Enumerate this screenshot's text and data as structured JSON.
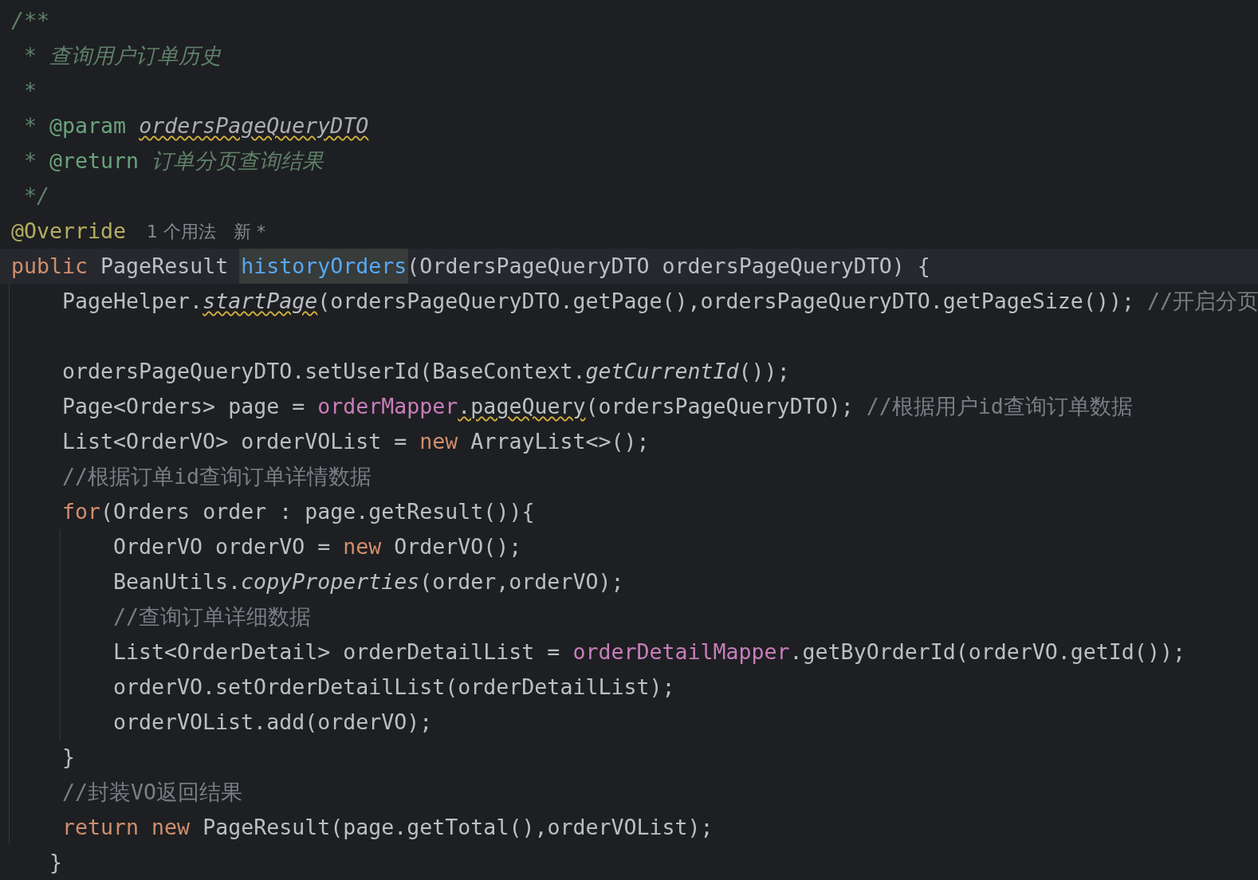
{
  "editor": {
    "lines": [
      {
        "kind": "code",
        "current": false,
        "tokens": [
          {
            "text": "/**",
            "kind": "doc"
          }
        ]
      },
      {
        "kind": "code",
        "current": false,
        "tokens": [
          {
            "text": " * 查询用户订单历史",
            "kind": "doc"
          }
        ]
      },
      {
        "kind": "code",
        "current": false,
        "tokens": [
          {
            "text": " *",
            "kind": "doc"
          }
        ]
      },
      {
        "kind": "code",
        "current": false,
        "tokens": [
          {
            "text": " * ",
            "kind": "doc"
          },
          {
            "text": "@param ",
            "kind": "doc_tag"
          },
          {
            "text": "ordersPageQueryDTO",
            "kind": "doc_param",
            "warning": true
          }
        ]
      },
      {
        "kind": "code",
        "current": false,
        "tokens": [
          {
            "text": " * ",
            "kind": "doc"
          },
          {
            "text": "@return",
            "kind": "doc_tag"
          },
          {
            "text": " 订单分页查询结果",
            "kind": "doc"
          }
        ]
      },
      {
        "kind": "code",
        "current": false,
        "tokens": [
          {
            "text": " */",
            "kind": "doc"
          }
        ]
      },
      {
        "kind": "code",
        "current": false,
        "tokens": [
          {
            "text": "@Override",
            "kind": "annotation"
          }
        ],
        "inlay_hints": [
          "1 个用法",
          "新 *"
        ]
      },
      {
        "kind": "code",
        "current": true,
        "tokens": [
          {
            "text": "public",
            "kind": "keyword"
          },
          {
            "text": " PageResult ",
            "kind": "plain"
          },
          {
            "text": "historyOrders",
            "kind": "method_decl",
            "highlighted": true
          },
          {
            "text": "(OrdersPageQueryDTO ordersPageQueryDTO) {",
            "kind": "plain"
          }
        ],
        "children": [
          {
            "kind": "code",
            "current": false,
            "tokens": [
              {
                "text": "PageHelper.",
                "kind": "plain"
              },
              {
                "text": "startPage",
                "kind": "static_call",
                "warning": true
              },
              {
                "text": "(ordersPageQueryDTO.getPage(),ordersPageQueryDTO.getPageSize()); ",
                "kind": "plain"
              },
              {
                "text": "//开启分页",
                "kind": "comment"
              }
            ]
          },
          {
            "kind": "blank",
            "current": false
          },
          {
            "kind": "code",
            "current": false,
            "tokens": [
              {
                "text": "ordersPageQueryDTO.setUserId(BaseContext.",
                "kind": "plain"
              },
              {
                "text": "getCurrentId",
                "kind": "static_call"
              },
              {
                "text": "());",
                "kind": "plain"
              }
            ]
          },
          {
            "kind": "code",
            "current": false,
            "tokens": [
              {
                "text": "Page<Orders> page = ",
                "kind": "plain"
              },
              {
                "text": "orderMapper",
                "kind": "field"
              },
              {
                "text": ".pageQuery",
                "kind": "plain",
                "warning": true
              },
              {
                "text": "(ordersPageQueryDTO); ",
                "kind": "plain"
              },
              {
                "text": "//根据用户id查询订单数据",
                "kind": "comment"
              }
            ]
          },
          {
            "kind": "code",
            "current": false,
            "tokens": [
              {
                "text": "List<OrderVO> orderVOList = ",
                "kind": "plain"
              },
              {
                "text": "new",
                "kind": "keyword"
              },
              {
                "text": " ArrayList<>();",
                "kind": "plain"
              }
            ]
          },
          {
            "kind": "code",
            "current": false,
            "tokens": [
              {
                "text": "//根据订单id查询订单详情数据",
                "kind": "comment"
              }
            ]
          },
          {
            "kind": "code",
            "current": false,
            "tokens": [
              {
                "text": "for",
                "kind": "keyword"
              },
              {
                "text": "(Orders order : page.getResult()){",
                "kind": "plain"
              }
            ],
            "children": [
              {
                "kind": "code",
                "current": false,
                "tokens": [
                  {
                    "text": "OrderVO orderVO = ",
                    "kind": "plain"
                  },
                  {
                    "text": "new",
                    "kind": "keyword"
                  },
                  {
                    "text": " OrderVO();",
                    "kind": "plain"
                  }
                ]
              },
              {
                "kind": "code",
                "current": false,
                "tokens": [
                  {
                    "text": "BeanUtils.",
                    "kind": "plain"
                  },
                  {
                    "text": "copyProperties",
                    "kind": "static_call"
                  },
                  {
                    "text": "(order,orderVO);",
                    "kind": "plain"
                  }
                ]
              },
              {
                "kind": "code",
                "current": false,
                "tokens": [
                  {
                    "text": "//查询订单详细数据",
                    "kind": "comment"
                  }
                ]
              },
              {
                "kind": "code",
                "current": false,
                "tokens": [
                  {
                    "text": "List<OrderDetail> orderDetailList = ",
                    "kind": "plain"
                  },
                  {
                    "text": "orderDetailMapper",
                    "kind": "field"
                  },
                  {
                    "text": ".getByOrderId(orderVO.getId());",
                    "kind": "plain"
                  }
                ]
              },
              {
                "kind": "code",
                "current": false,
                "tokens": [
                  {
                    "text": "orderVO.setOrderDetailList(orderDetailList);",
                    "kind": "plain"
                  }
                ]
              },
              {
                "kind": "code",
                "current": false,
                "tokens": [
                  {
                    "text": "orderVOList.add(orderVO);",
                    "kind": "plain"
                  }
                ]
              }
            ]
          },
          {
            "kind": "code",
            "current": false,
            "tokens": [
              {
                "text": "}",
                "kind": "plain"
              }
            ]
          },
          {
            "kind": "code",
            "current": false,
            "tokens": [
              {
                "text": "//封装VO返回结果",
                "kind": "comment"
              }
            ]
          },
          {
            "kind": "code",
            "current": false,
            "tokens": [
              {
                "text": "return ",
                "kind": "keyword"
              },
              {
                "text": "new",
                "kind": "keyword"
              },
              {
                "text": " PageResult(page.getTotal(),orderVOList);",
                "kind": "plain"
              }
            ]
          }
        ]
      },
      {
        "kind": "code",
        "current": false,
        "tokens": [
          {
            "text": "   }",
            "kind": "plain"
          }
        ]
      }
    ]
  }
}
